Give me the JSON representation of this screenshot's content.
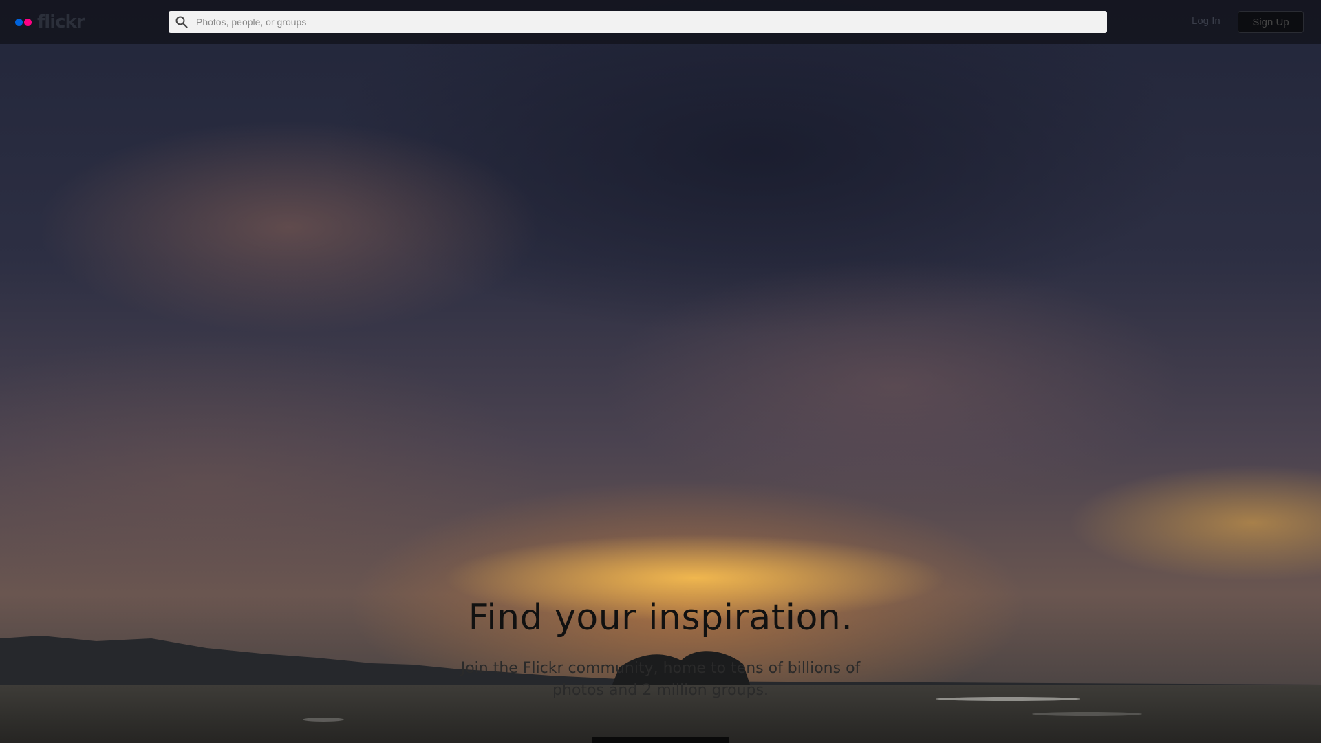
{
  "header": {
    "logo_text": "flickr",
    "logo_colors": [
      "#0063dc",
      "#ff0084"
    ],
    "search": {
      "placeholder": "Photos, people, or groups",
      "icon": "search-icon"
    },
    "login_label": "Log In",
    "signup_label": "Sign Up"
  },
  "hero": {
    "title": "Find your inspiration.",
    "subtitle": "Join the Flickr community, home to tens of billions of photos and 2 million groups."
  }
}
